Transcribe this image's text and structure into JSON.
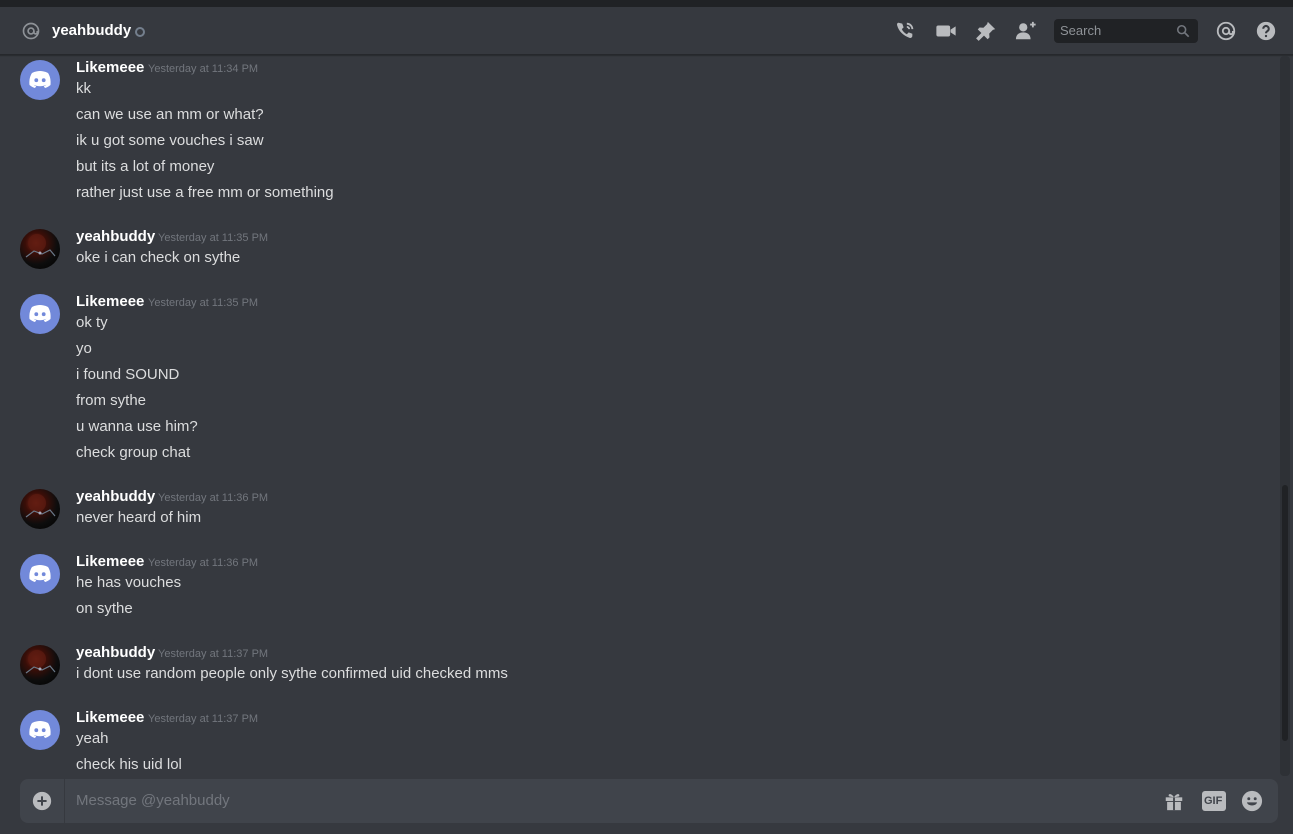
{
  "header": {
    "channel_name": "yeahbuddy",
    "search_placeholder": "Search"
  },
  "messages": [
    {
      "author": "Likemeee",
      "avatar": "discord-logo",
      "timestamp": "Yesterday at 11:34 PM",
      "lines": [
        "kk",
        "can we use an mm or what?",
        "ik u got some vouches i saw",
        "but its a lot of money",
        "rather just use a free mm or something"
      ]
    },
    {
      "author": "yeahbuddy",
      "avatar": "photo",
      "timestamp": "Yesterday at 11:35 PM",
      "lines": [
        "oke i can check on sythe"
      ]
    },
    {
      "author": "Likemeee",
      "avatar": "discord-logo",
      "timestamp": "Yesterday at 11:35 PM",
      "lines": [
        "ok ty",
        "yo",
        "i found SOUND",
        "from sythe",
        "u wanna use him?",
        "check group chat"
      ]
    },
    {
      "author": "yeahbuddy",
      "avatar": "photo",
      "timestamp": "Yesterday at 11:36 PM",
      "lines": [
        "never heard of him"
      ]
    },
    {
      "author": "Likemeee",
      "avatar": "discord-logo",
      "timestamp": "Yesterday at 11:36 PM",
      "lines": [
        "he has vouches",
        "on sythe"
      ]
    },
    {
      "author": "yeahbuddy",
      "avatar": "photo",
      "timestamp": "Yesterday at 11:37 PM",
      "lines": [
        "i dont use random people only sythe confirmed uid checked mms"
      ]
    },
    {
      "author": "Likemeee",
      "avatar": "discord-logo",
      "timestamp": "Yesterday at 11:37 PM",
      "lines": [
        "yeah",
        "check his uid lol"
      ]
    }
  ],
  "composer": {
    "placeholder": "Message @yeahbuddy",
    "gif_label": "GIF"
  },
  "colors": {
    "background": "#36393f",
    "discord_blurple": "#7289da",
    "timestamp": "#72767d",
    "text": "#dcddde"
  }
}
